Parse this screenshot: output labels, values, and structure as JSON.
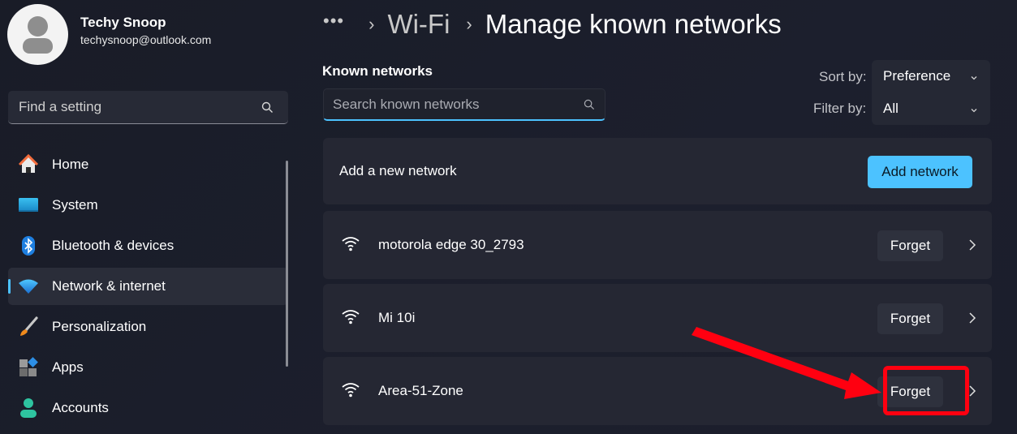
{
  "profile": {
    "name": "Techy Snoop",
    "email": "techysnoop@outlook.com"
  },
  "sidebar": {
    "search_placeholder": "Find a setting",
    "items": [
      {
        "label": "Home",
        "icon": "home-icon",
        "active": false
      },
      {
        "label": "System",
        "icon": "system-icon",
        "active": false
      },
      {
        "label": "Bluetooth & devices",
        "icon": "bluetooth-icon",
        "active": false
      },
      {
        "label": "Network & internet",
        "icon": "wifi-icon",
        "active": true
      },
      {
        "label": "Personalization",
        "icon": "brush-icon",
        "active": false
      },
      {
        "label": "Apps",
        "icon": "apps-icon",
        "active": false
      },
      {
        "label": "Accounts",
        "icon": "account-icon",
        "active": false
      }
    ]
  },
  "breadcrumb": {
    "more": "•••",
    "separator": "›",
    "parent": "Wi-Fi",
    "current": "Manage known networks"
  },
  "known_networks": {
    "heading": "Known networks",
    "search_placeholder": "Search known networks",
    "sort_label": "Sort by:",
    "sort_value": "Preference",
    "filter_label": "Filter by:",
    "filter_value": "All",
    "add_card": {
      "label": "Add a new network",
      "button": "Add network"
    },
    "networks": [
      {
        "name": "motorola edge 30_2793",
        "action": "Forget"
      },
      {
        "name": "Mi 10i",
        "action": "Forget"
      },
      {
        "name": "Area-51-Zone",
        "action": "Forget",
        "highlighted": true
      }
    ]
  },
  "colors": {
    "accent": "#4cc2ff",
    "annotation": "#ff0010"
  }
}
